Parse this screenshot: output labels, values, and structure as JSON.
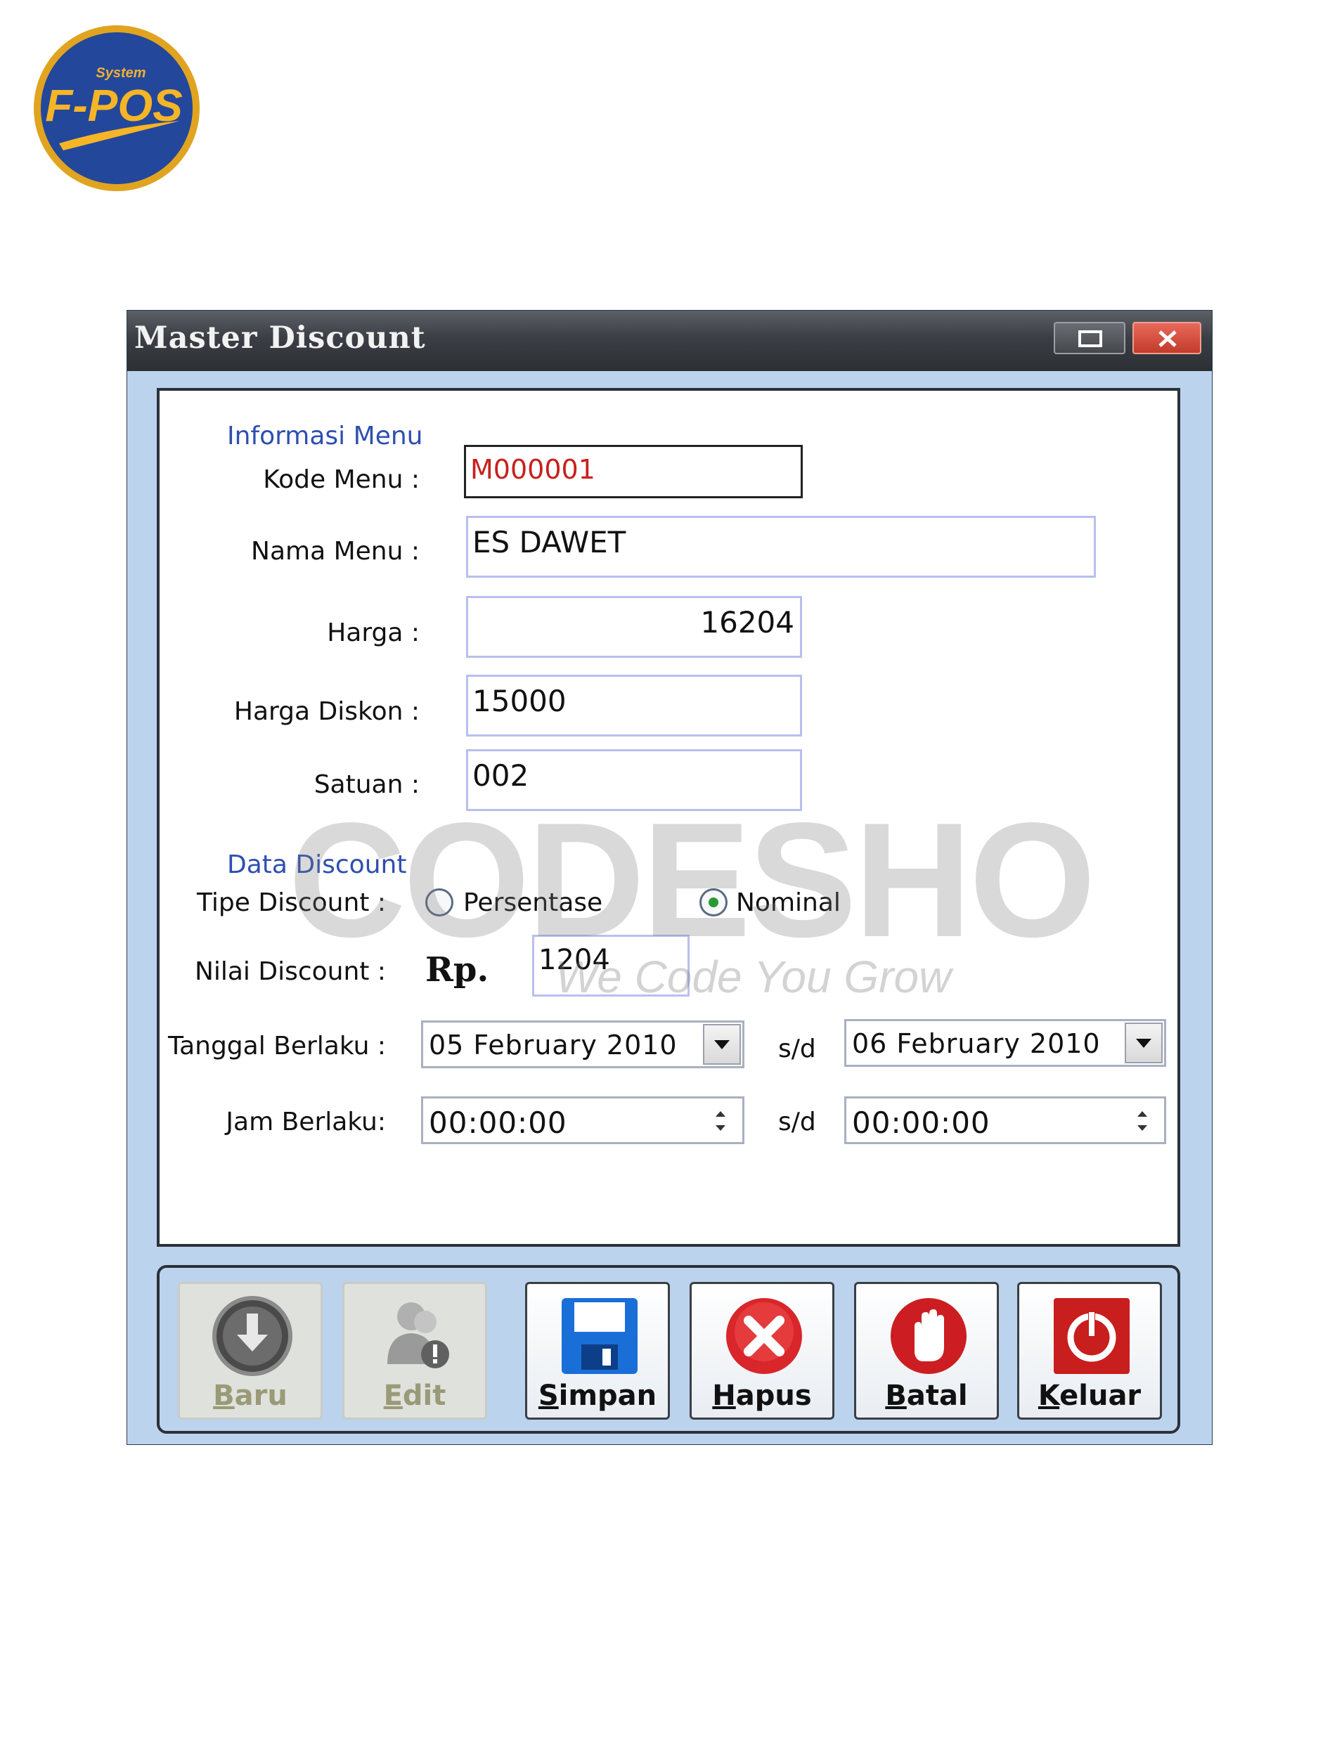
{
  "logo": {
    "small_text": "System",
    "text": "F-POS"
  },
  "window": {
    "title": "Master Discount"
  },
  "form": {
    "section_menu": "Informasi Menu",
    "kode_label": "Kode Menu :",
    "kode_value": "M000001",
    "nama_label": "Nama Menu :",
    "nama_value": "ES DAWET",
    "harga_label": "Harga :",
    "harga_value": "16204",
    "harga_diskon_label": "Harga Diskon :",
    "harga_diskon_value": "15000",
    "satuan_label": "Satuan :",
    "satuan_value": "002",
    "section_discount": "Data Discount",
    "tipe_label": "Tipe Discount :",
    "radio_persentase": "Persentase",
    "radio_nominal": "Nominal",
    "selected_tipe": "Nominal",
    "nilai_label": "Nilai Discount :",
    "currency": "Rp.",
    "nilai_value": "1204",
    "tanggal_label": "Tanggal Berlaku :",
    "tanggal_from": "05  February  2010",
    "tanggal_to": "06  February  2010",
    "sd": "s/d",
    "jam_label": "Jam Berlaku:",
    "jam_from": "00:00:00",
    "jam_to": "00:00:00"
  },
  "watermark": {
    "brand": "CODESHOP",
    "tagline": "We Code You Grow"
  },
  "buttons": [
    {
      "mnemonic": "B",
      "rest": "aru",
      "icon": "download-icon",
      "enabled": false
    },
    {
      "mnemonic": "E",
      "rest": "dit",
      "icon": "users-edit-icon",
      "enabled": false
    },
    {
      "mnemonic": "S",
      "rest": "impan",
      "icon": "floppy-disk-icon",
      "enabled": true
    },
    {
      "mnemonic": "H",
      "rest": "apus",
      "icon": "delete-x-icon",
      "enabled": true
    },
    {
      "mnemonic": "B",
      "rest": "atal",
      "icon": "stop-hand-icon",
      "enabled": true
    },
    {
      "mnemonic": "K",
      "rest": "eluar",
      "icon": "power-icon",
      "enabled": true
    }
  ],
  "colors": {
    "accent": "#2d4fb0",
    "window_bg": "#bcd3ee",
    "titlebar": "#3b3f45",
    "kode_text": "#c8201c"
  }
}
